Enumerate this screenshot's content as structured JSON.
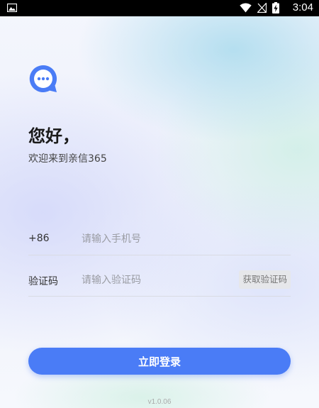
{
  "status_bar": {
    "time": "3:04",
    "icons": [
      "gallery-icon",
      "wifi-icon",
      "signal-off-icon",
      "battery-charging-icon"
    ]
  },
  "brand": {
    "logo_icon": "chat-bubble-icon",
    "accent_color": "#4a7cf6"
  },
  "greeting": {
    "title": "您好，",
    "subtitle": "欢迎来到亲信365"
  },
  "form": {
    "phone": {
      "prefix": "+86",
      "placeholder": "请输入手机号",
      "value": ""
    },
    "code": {
      "label": "验证码",
      "placeholder": "请输入验证码",
      "value": "",
      "get_code_label": "获取验证码"
    },
    "login_label": "立即登录"
  },
  "footer": {
    "version": "v1.0.06"
  }
}
